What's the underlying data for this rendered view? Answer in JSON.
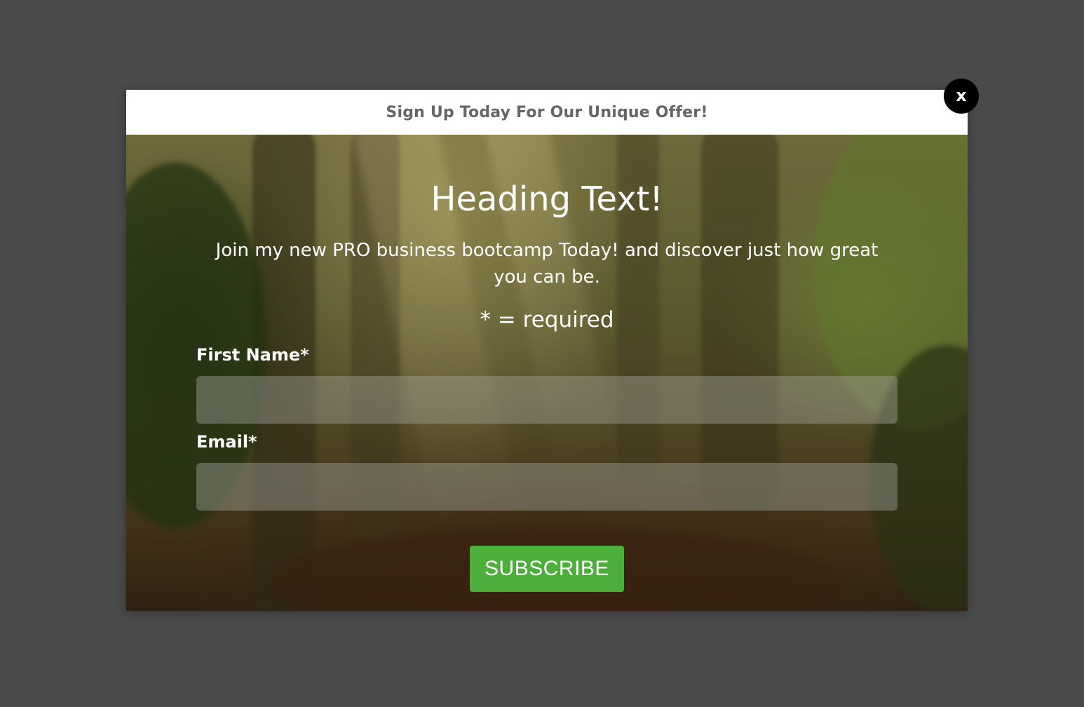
{
  "modal": {
    "header_title": "Sign Up Today For Our Unique Offer!",
    "close_label": "x"
  },
  "body": {
    "heading": "Heading Text!",
    "subtext": "Join my new PRO business bootcamp Today! and discover just how great you can be.",
    "required_note": "* = required"
  },
  "form": {
    "first_name": {
      "label": "First Name*",
      "value": "",
      "placeholder": ""
    },
    "email": {
      "label": "Email*",
      "value": "",
      "placeholder": ""
    },
    "submit_label": "SUBSCRIBE"
  },
  "colors": {
    "overlay": "#4a4a4a",
    "header_bg": "#ffffff",
    "header_text": "#666666",
    "close_bg": "#000000",
    "submit_bg": "#4caf3a"
  }
}
